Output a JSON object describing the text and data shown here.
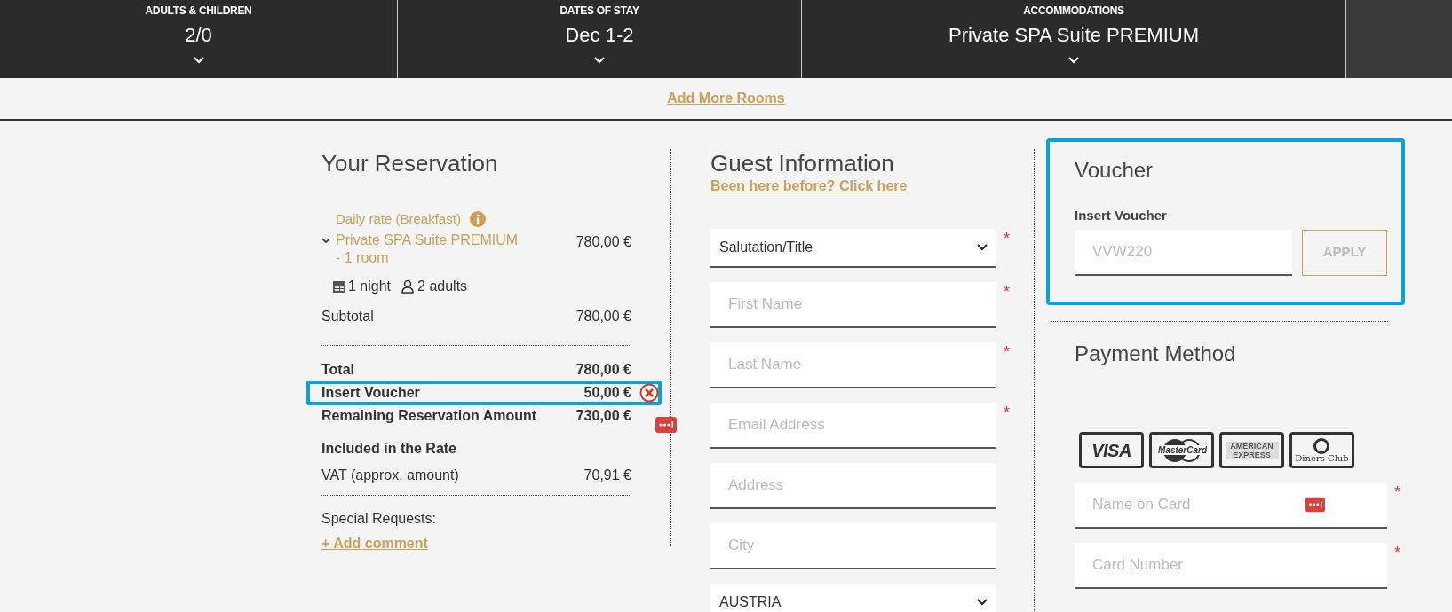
{
  "booking_bar": {
    "items": [
      {
        "label": "ADULTS & CHILDREN",
        "value": "2/0"
      },
      {
        "label": "DATES OF STAY",
        "value": "Dec 1-2"
      },
      {
        "label": "ACCOMMODATIONS",
        "value": "Private SPA Suite PREMIUM"
      }
    ]
  },
  "add_rooms_link": "Add More Rooms",
  "reservation": {
    "title": "Your Reservation",
    "rate_name": "Daily rate (Breakfast)",
    "room": {
      "name": "Private SPA Suite PREMIUM",
      "qty": "- 1 room",
      "price": "780,00 €",
      "expanded": true
    },
    "nights": "1 night",
    "guests": "2 adults",
    "subtotal": {
      "label": "Subtotal",
      "amount": "780,00 €"
    },
    "totals": [
      {
        "label": "Total",
        "amount": "780,00 €",
        "kind": "total"
      },
      {
        "label": "Insert Voucher",
        "amount": "50,00 €",
        "kind": "voucher",
        "highlighted": true
      },
      {
        "label": "Remaining Reservation Amount",
        "amount": "730,00 €",
        "kind": "total"
      }
    ],
    "included_title": "Included in the Rate",
    "vat": {
      "label": "VAT (approx. amount)",
      "amount": "70,91 €"
    },
    "special_requests": "Special Requests:",
    "add_comment": "+ Add comment"
  },
  "guest": {
    "title": "Guest Information",
    "returning_link": "Been here before? Click here",
    "fields": [
      {
        "kind": "select",
        "value": "Salutation/Title",
        "required_mark": "*"
      },
      {
        "kind": "text",
        "placeholder": "First Name",
        "required_mark": "*"
      },
      {
        "kind": "text",
        "placeholder": "Last Name",
        "required_mark": "*"
      },
      {
        "kind": "text",
        "placeholder": "Email Address",
        "required_mark": "*",
        "autofill_badge": true
      },
      {
        "kind": "text",
        "placeholder": "Address"
      },
      {
        "kind": "text",
        "placeholder": "City"
      },
      {
        "kind": "select",
        "value": "AUSTRIA"
      }
    ]
  },
  "voucher": {
    "title": "Voucher",
    "label": "Insert Voucher",
    "placeholder": "VVW220",
    "button": "APPLY",
    "highlighted": true
  },
  "payment": {
    "title": "Payment Method",
    "cards": [
      "VISA",
      "MasterCard",
      "AMERICAN EXPRESS",
      "Diners Club"
    ],
    "fields": [
      {
        "placeholder": "Name on Card",
        "required_mark": "*",
        "autofill_badge": true
      },
      {
        "placeholder": "Card Number",
        "required_mark": "*"
      }
    ]
  }
}
